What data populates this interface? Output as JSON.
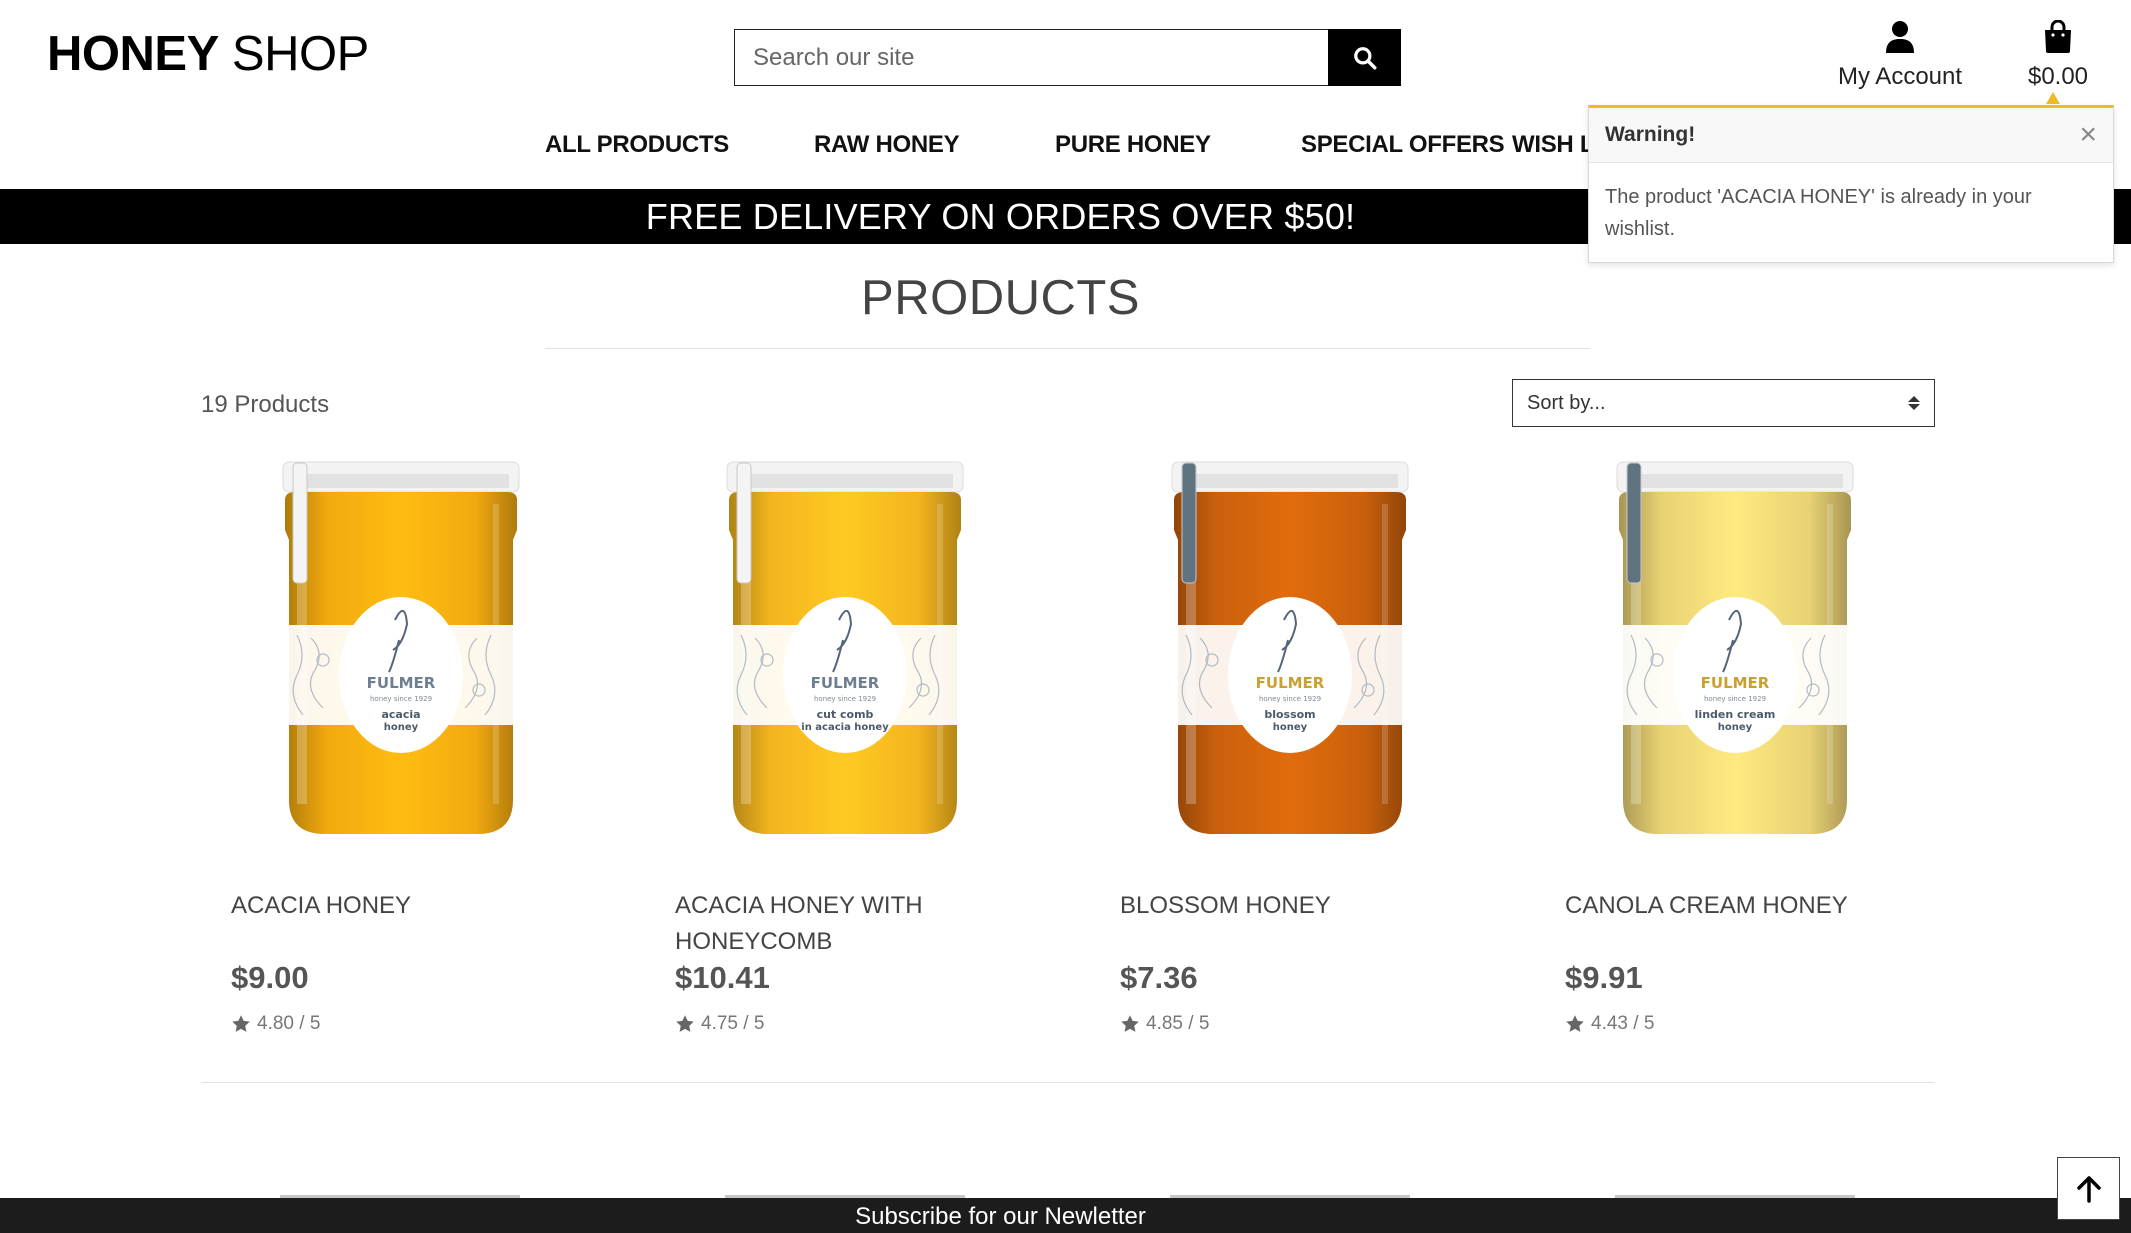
{
  "header": {
    "logo_strong": "HONEY",
    "logo_light": "SHOP",
    "search_placeholder": "Search our site",
    "account_label": "My Account",
    "bag_total": "$0.00"
  },
  "nav": {
    "items": [
      "ALL PRODUCTS",
      "RAW HONEY",
      "PURE HONEY",
      "SPECIAL OFFERS",
      "WISH L"
    ]
  },
  "banner": "FREE DELIVERY ON ORDERS OVER $50!",
  "toast": {
    "title": "Warning!",
    "message": "The product 'ACACIA HONEY' is already in your wishlist.",
    "close": "×",
    "accent": "#f0b823"
  },
  "main": {
    "title": "PRODUCTS",
    "count": "19 Products",
    "sort_label": "Sort by..."
  },
  "products": [
    {
      "name": "ACACIA HONEY",
      "price": "$9.00",
      "rating": "4.80 / 5",
      "label_type": "acacia honey",
      "color": "#f2a90f"
    },
    {
      "name": "ACACIA HONEY WITH HONEYCOMB",
      "price": "$10.41",
      "rating": "4.75 / 5",
      "label_type": "cut comb in acacia honey",
      "color": "#f3b41e"
    },
    {
      "name": "BLOSSOM HONEY",
      "price": "$7.36",
      "rating": "4.85 / 5",
      "label_type": "blossom honey",
      "color": "#c9600c"
    },
    {
      "name": "CANOLA CREAM HONEY",
      "price": "$9.91",
      "rating": "4.43 / 5",
      "label_type": "linden cream honey",
      "color": "#e8d173"
    }
  ],
  "jar_brand": "FULMER",
  "jar_since": "honey since 1929",
  "footer": {
    "subscribe": "Subscribe for our Newletter"
  },
  "icons": {
    "search": "search-icon",
    "account": "user-icon",
    "bag": "shopping-bag-icon",
    "star": "star-icon",
    "close": "close-icon",
    "to_top": "arrow-up-icon"
  }
}
